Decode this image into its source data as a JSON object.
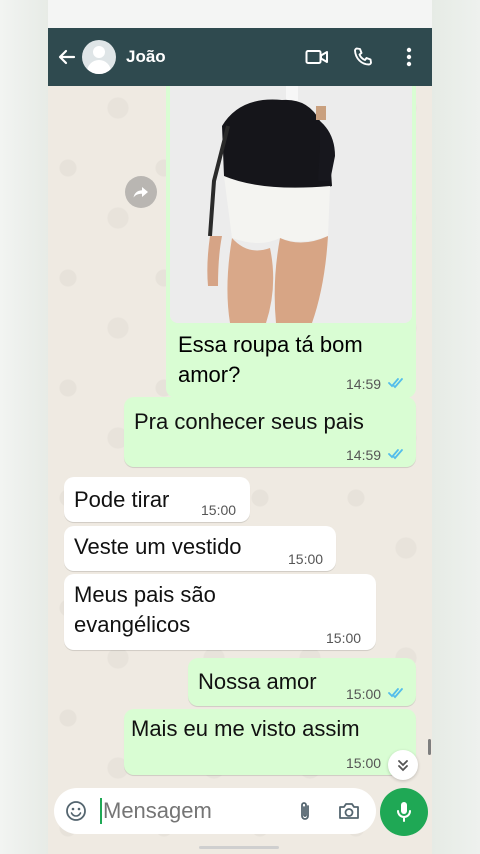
{
  "header": {
    "contact_name": "João",
    "icons": [
      "back-arrow-icon",
      "avatar",
      "video-call-icon",
      "phone-call-icon",
      "more-vert-icon"
    ]
  },
  "messages": [
    {
      "direction": "out",
      "text": "Essa roupa tá bom amor?",
      "time": "14:59",
      "read": true
    },
    {
      "direction": "out",
      "text": "Pra conhecer seus pais",
      "time": "14:59",
      "read": true
    },
    {
      "direction": "in",
      "text": "Pode tirar",
      "time": "15:00"
    },
    {
      "direction": "in",
      "text": "Veste um vestido",
      "time": "15:00"
    },
    {
      "direction": "in",
      "text": "Meus pais são evangélicos",
      "time": "15:00"
    },
    {
      "direction": "out",
      "text": "Nossa amor",
      "time": "15:00",
      "read": true
    },
    {
      "direction": "out",
      "text": "Mais eu me visto assim",
      "time": "15:00"
    }
  ],
  "composer": {
    "placeholder": "Mensagem"
  },
  "colors": {
    "header_bg": "#2f4a4f",
    "outgoing_bubble": "#d9fdd3",
    "incoming_bubble": "#ffffff",
    "read_ticks": "#53bdeb",
    "mic_button": "#1fa855"
  }
}
